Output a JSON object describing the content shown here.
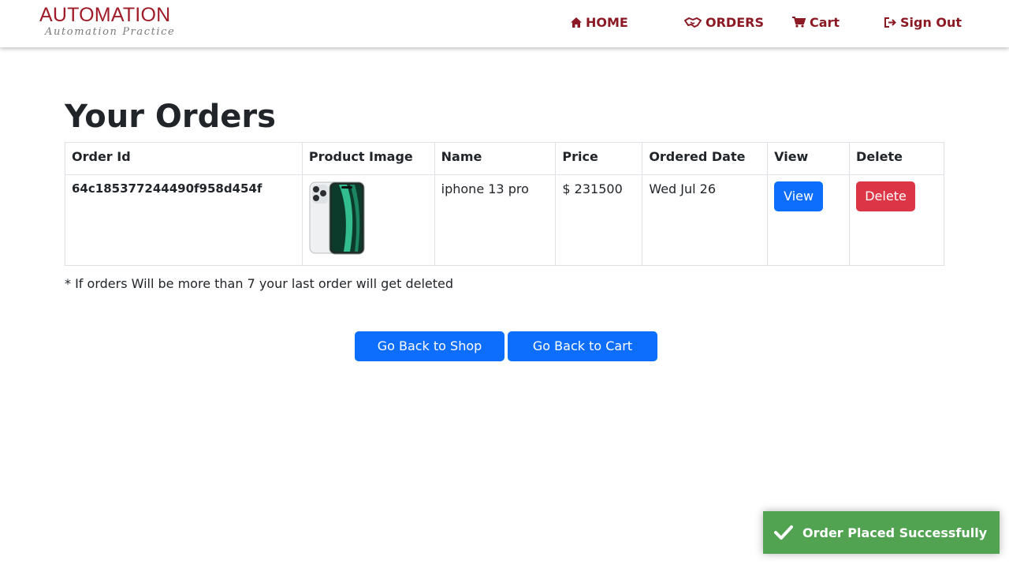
{
  "brand": {
    "title": "AUTOMATION",
    "subtitle": "Automation Practice"
  },
  "nav": {
    "home": "HOME",
    "orders": "ORDERS",
    "cart": "Cart",
    "sign_out": "Sign Out"
  },
  "page": {
    "title": "Your Orders"
  },
  "table": {
    "headers": [
      "Order Id",
      "Product Image",
      "Name",
      "Price",
      "Ordered Date",
      "View",
      "Delete"
    ],
    "rows": [
      {
        "order_id": "64c185377244490f958d454f",
        "product_image": "iphone-13-pro-image",
        "name": "iphone 13 pro",
        "price": "$ 231500",
        "ordered_date": "Wed Jul 26",
        "view_label": "View",
        "delete_label": "Delete"
      }
    ]
  },
  "note": "* If orders Will be more than 7 your last order will get deleted",
  "actions": {
    "back_to_shop": "Go Back to Shop",
    "back_to_cart": "Go Back to Cart"
  },
  "toast": {
    "message": "Order Placed Successfully",
    "icon": "check-icon"
  },
  "colors": {
    "brand": "#a01c28",
    "nav_text": "#8b1a24",
    "primary": "#0d6efd",
    "danger": "#dc3545",
    "success_toast": "#51a351"
  }
}
